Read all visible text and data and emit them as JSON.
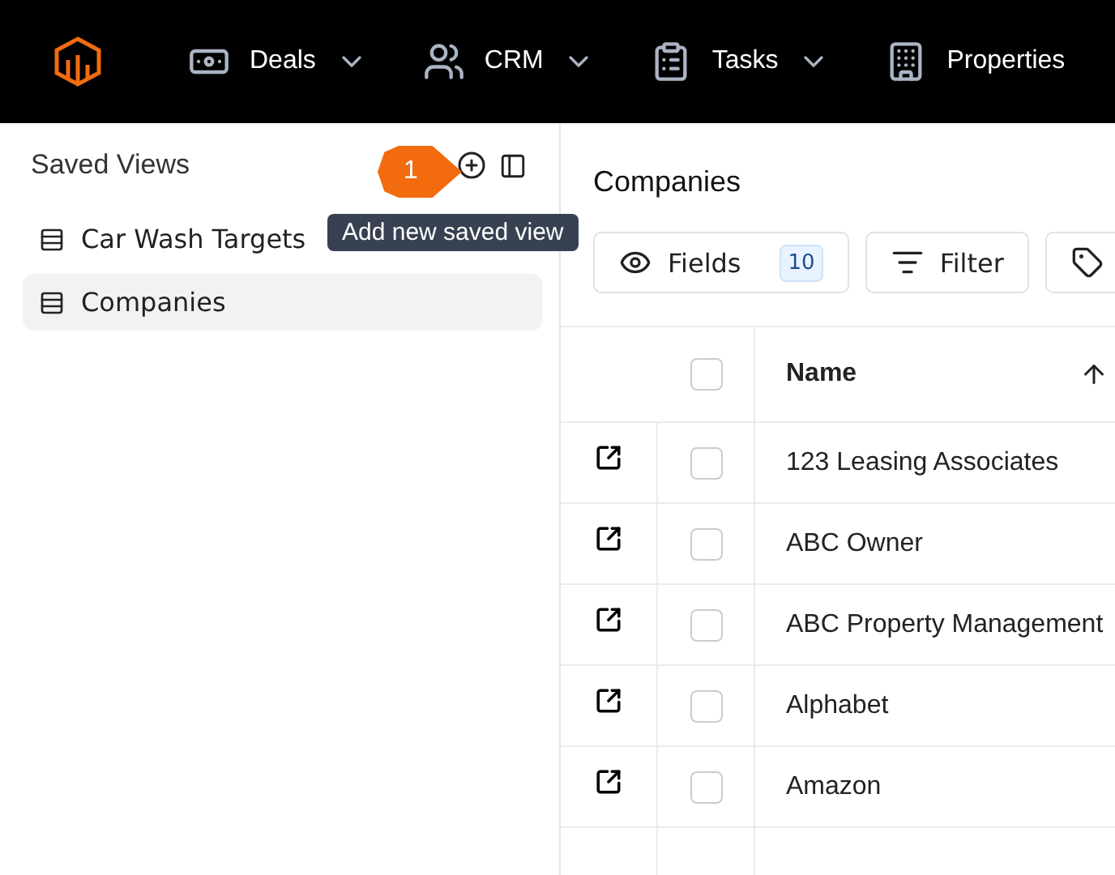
{
  "nav": {
    "items": [
      {
        "label": "Deals",
        "has_menu": true
      },
      {
        "label": "CRM",
        "has_menu": true
      },
      {
        "label": "Tasks",
        "has_menu": true
      },
      {
        "label": "Properties",
        "has_menu": false
      }
    ]
  },
  "sidebar": {
    "title": "Saved Views",
    "step_badge": "1",
    "tooltip": "Add new saved view",
    "items": [
      {
        "label": "Car Wash Targets",
        "selected": false
      },
      {
        "label": "Companies",
        "selected": true
      }
    ]
  },
  "main": {
    "title": "Companies",
    "toolbar": [
      {
        "kind": "fields",
        "label": "Fields",
        "count": "10"
      },
      {
        "kind": "filter",
        "label": "Filter"
      },
      {
        "kind": "tag"
      }
    ],
    "table": {
      "columns": [
        {
          "label": "Name"
        }
      ],
      "all_checked": false,
      "rows": [
        {
          "name": "123 Leasing Associates",
          "checked": false
        },
        {
          "name": "ABC Owner",
          "checked": false
        },
        {
          "name": "ABC Property Management",
          "checked": false
        },
        {
          "name": "Alphabet",
          "checked": false
        },
        {
          "name": "Amazon",
          "checked": false
        }
      ]
    }
  }
}
